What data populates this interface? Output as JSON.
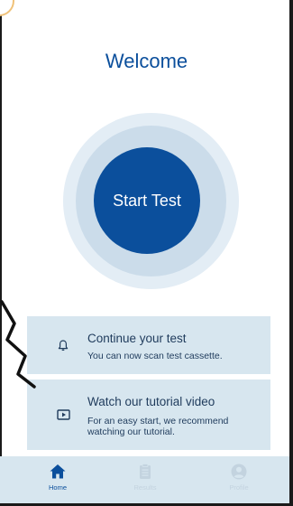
{
  "header": {
    "title": "Welcome"
  },
  "start_button": {
    "label": "Start Test"
  },
  "cards": [
    {
      "icon": "bell-icon",
      "title": "Continue your test",
      "subtitle": "You can now scan test cassette."
    },
    {
      "icon": "play-video-icon",
      "title": "Watch our tutorial video",
      "subtitle": "For an easy start, we recommend watching our tutorial."
    }
  ],
  "tabbar": {
    "tabs": [
      {
        "label": "Home",
        "icon": "home-icon",
        "active": true
      },
      {
        "label": "Results",
        "icon": "clipboard-icon",
        "active": false
      },
      {
        "label": "Profile",
        "icon": "user-icon",
        "active": false
      }
    ]
  },
  "colors": {
    "primary": "#0b4f9c",
    "card_bg": "#d7e6ef",
    "ring_outer": "#e3edf5",
    "ring_mid": "#cbdcea",
    "inactive_tab": "#c3d3df"
  }
}
